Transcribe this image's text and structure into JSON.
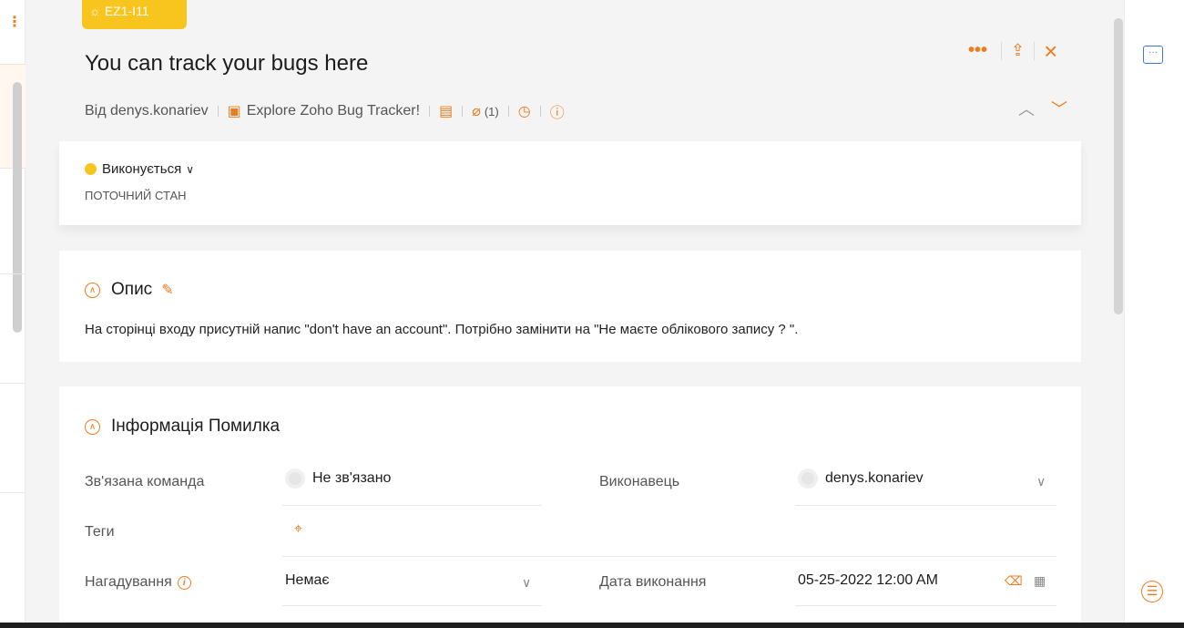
{
  "bug": {
    "id": "EZ1-I11",
    "title": "You can track your bugs here"
  },
  "meta": {
    "reporter": "Від denys.konariev",
    "project": "Explore Zoho Bug Tracker!",
    "attachments_count": "(1)"
  },
  "status": {
    "current": "Виконується",
    "caption": "ПОТОЧНИЙ СТАН"
  },
  "description": {
    "title": "Опис",
    "text": "На сторінці входу присутній напис  \"don't have an account\". Потрібно замінити  на \"Не маєте облікового запису ? \"."
  },
  "info": {
    "title": "Інформація Помилка",
    "fields": {
      "team_label": "Зв'язана команда",
      "team_value": "Не зв'язано",
      "assignee_label": "Виконавець",
      "assignee_value": "denys.konariev",
      "tags_label": "Теги",
      "reminder_label": "Нагадування",
      "reminder_value": "Немає",
      "due_label": "Дата виконання",
      "due_value": "05-25-2022 12:00 AM"
    }
  },
  "colors": {
    "accent": "#f07b1d",
    "status": "#f7c51e",
    "chat": "#3d7bd9"
  }
}
